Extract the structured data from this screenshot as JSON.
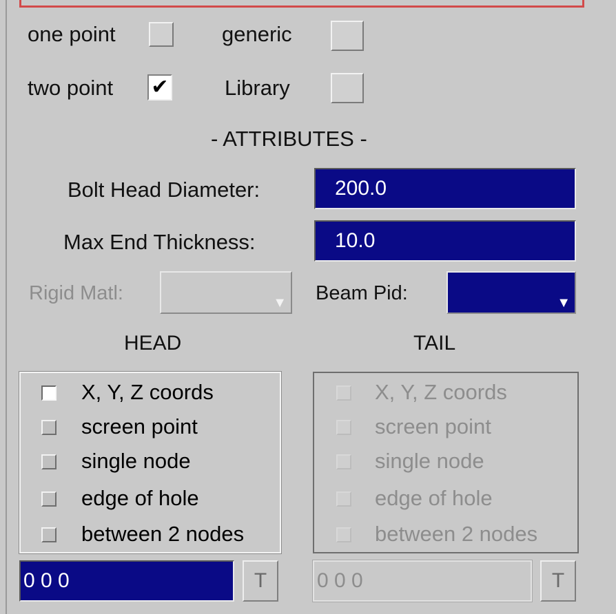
{
  "mode": {
    "one_point": {
      "label": "one point",
      "checked": false
    },
    "two_point": {
      "label": "two point",
      "checked": true,
      "mark": "✔"
    },
    "generic": {
      "label": "generic",
      "checked": false
    },
    "library": {
      "label": "Library",
      "checked": false
    }
  },
  "attributes": {
    "header": "- ATTRIBUTES -",
    "bolt_head_diameter": {
      "label": "Bolt Head Diameter:",
      "value": "200.0"
    },
    "max_end_thickness": {
      "label": "Max End Thickness:",
      "value": "10.0"
    },
    "rigid_matl": {
      "label": "Rigid Matl:",
      "value": "",
      "enabled": false
    },
    "beam_pid": {
      "label": "Beam Pid:",
      "value": ""
    }
  },
  "head": {
    "title": "HEAD",
    "options": [
      "X, Y, Z coords",
      "screen point",
      "single node",
      "edge of hole",
      "between 2 nodes"
    ],
    "selected": "X, Y, Z coords",
    "coords": "0 0 0",
    "t_label": "T"
  },
  "tail": {
    "title": "TAIL",
    "options": [
      "X, Y, Z coords",
      "screen point",
      "single node",
      "edge of hole",
      "between 2 nodes"
    ],
    "enabled": false,
    "coords": "0 0 0",
    "t_label": "T"
  },
  "colors": {
    "field_bg": "#0a0a86",
    "panel_bg": "#c9c9c9",
    "accent_border": "#d24a4a"
  },
  "icons": {
    "dropdown_arrow": "▼"
  }
}
